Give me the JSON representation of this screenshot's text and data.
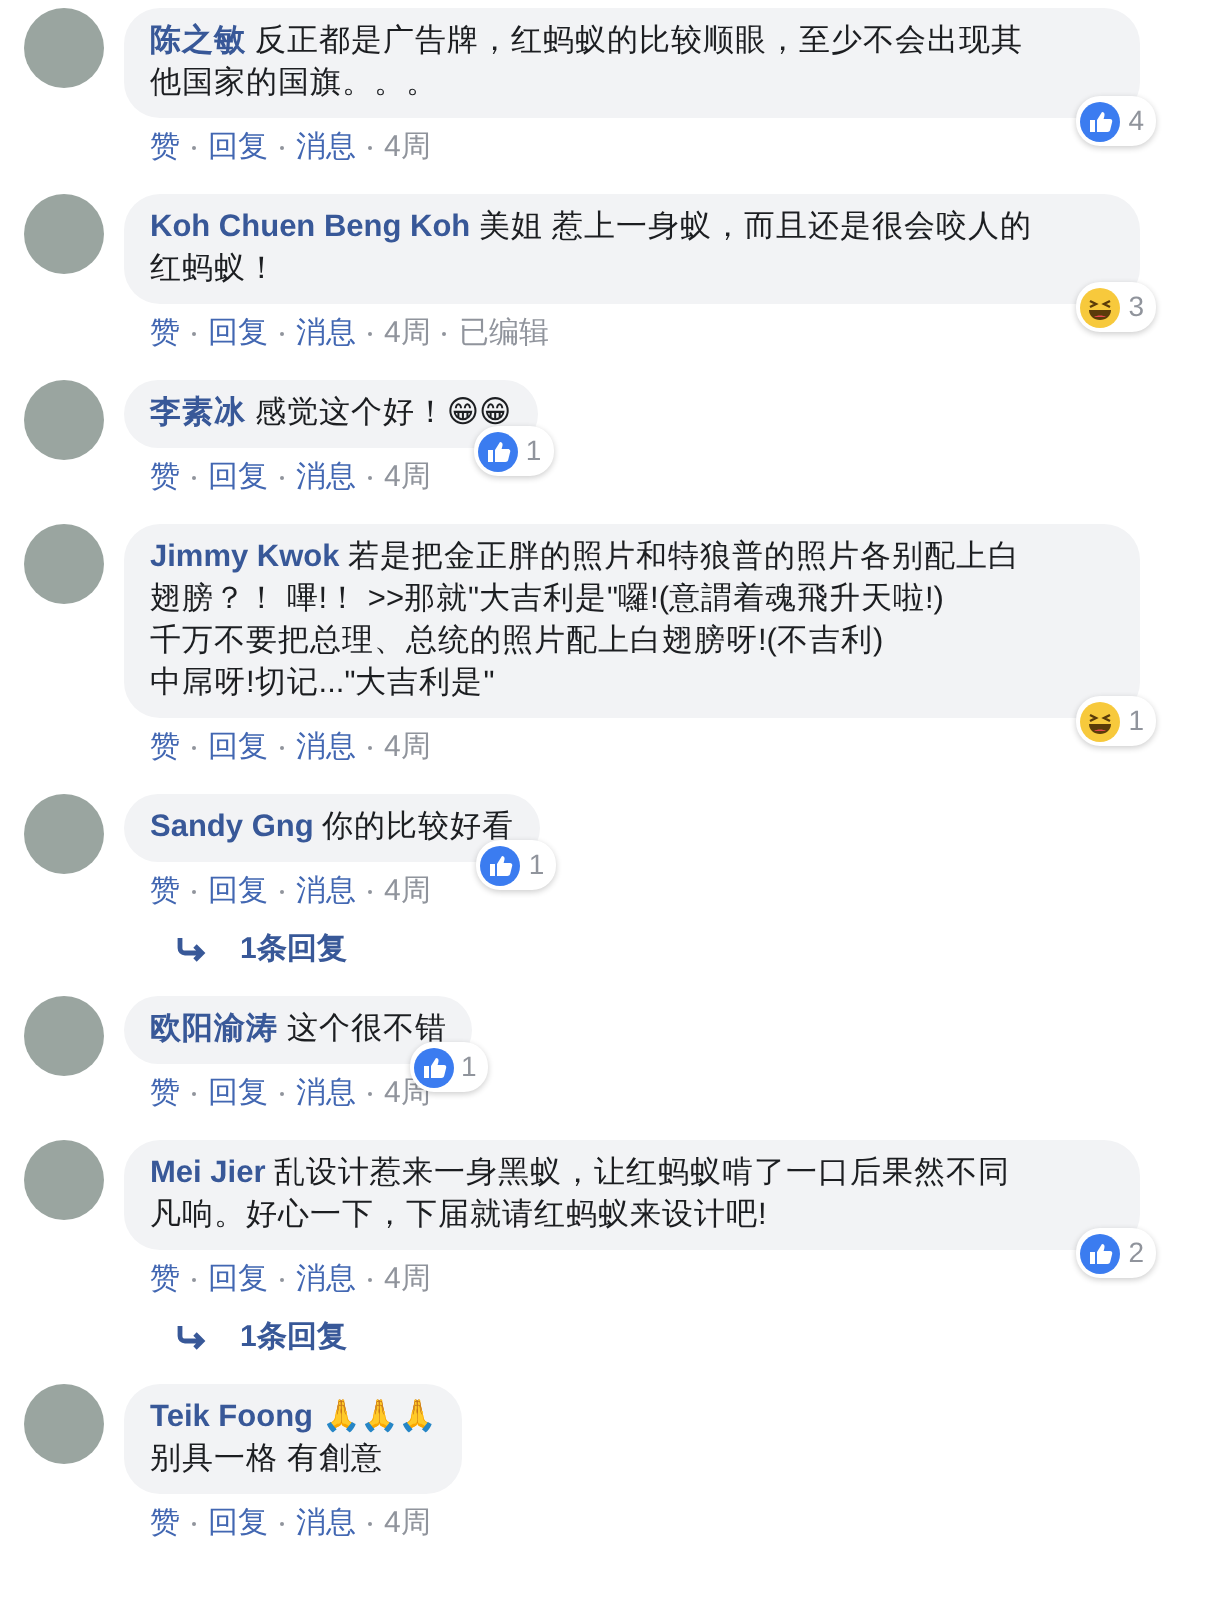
{
  "comments": [
    {
      "author": "陈之敏",
      "lines": [
        "反正都是广告牌，红蚂蚁的比较顺眼，至少不会出现其",
        "他国家的国旗。。。"
      ],
      "reaction": {
        "kind": "like",
        "count": "4"
      },
      "actions": [
        "赞",
        "回复",
        "消息"
      ],
      "time": "4周"
    },
    {
      "author": "Koh Chuen Beng Koh",
      "lines": [
        "美姐 惹上一身蚁，而且还是很会咬人的",
        "红蚂蚁！"
      ],
      "reaction": {
        "kind": "haha",
        "count": "3"
      },
      "actions": [
        "赞",
        "回复",
        "消息"
      ],
      "time": "4周",
      "edited": "已编辑"
    },
    {
      "author": "李素冰",
      "lines": [
        "感觉这个好！😁😁"
      ],
      "reaction": {
        "kind": "like",
        "count": "1"
      },
      "actions": [
        "赞",
        "回复",
        "消息"
      ],
      "time": "4周"
    },
    {
      "author": "Jimmy Kwok",
      "lines": [
        "若是把金正胖的照片和特狼普的照片各别配上白",
        "翅膀？！ 嗶!！ >>那就\"大吉利是\"囉!(意謂着魂飛升天啦!)",
        "千万不要把总理、总统的照片配上白翅膀呀!(不吉利)",
        "中屌呀!切记...\"大吉利是\""
      ],
      "reaction": {
        "kind": "haha",
        "count": "1"
      },
      "actions": [
        "赞",
        "回复",
        "消息"
      ],
      "time": "4周"
    },
    {
      "author": "Sandy Gng",
      "lines": [
        "你的比较好看"
      ],
      "reaction": {
        "kind": "like",
        "count": "1"
      },
      "actions": [
        "赞",
        "回复",
        "消息"
      ],
      "time": "4周",
      "replies": "1条回复"
    },
    {
      "author": "欧阳渝涛",
      "lines": [
        "这个很不错"
      ],
      "reaction": {
        "kind": "like",
        "count": "1"
      },
      "actions": [
        "赞",
        "回复",
        "消息"
      ],
      "time": "4周"
    },
    {
      "author": "Mei Jier",
      "lines": [
        "乱设计惹来一身黑蚁，让红蚂蚁啃了一口后果然不同",
        "凡响。好心一下，下届就请红蚂蚁来设计吧!"
      ],
      "reaction": {
        "kind": "like",
        "count": "2"
      },
      "actions": [
        "赞",
        "回复",
        "消息"
      ],
      "time": "4周",
      "replies": "1条回复"
    },
    {
      "author": "Teik Foong",
      "lines": [
        "🙏🙏🙏",
        "别具一格 有創意"
      ],
      "actions": [
        "赞",
        "回复",
        "消息"
      ],
      "time": "4周"
    }
  ]
}
